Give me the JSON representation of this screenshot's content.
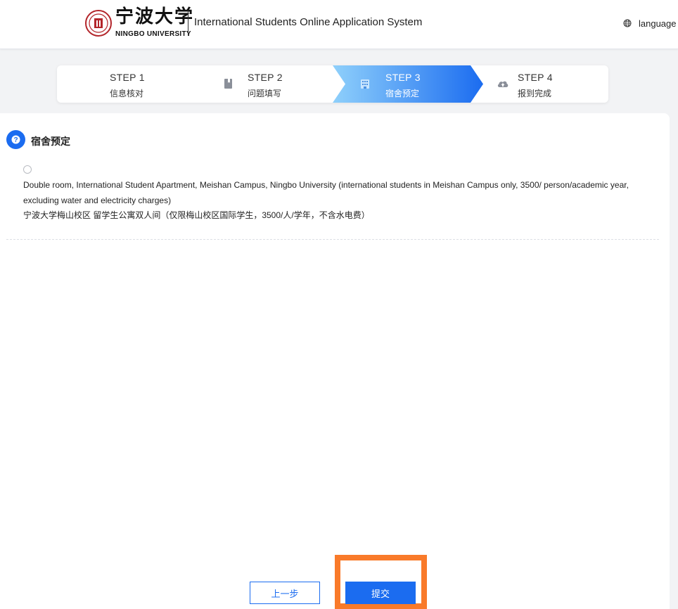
{
  "header": {
    "logo_cn": "宁波大学",
    "logo_en": "NINGBO UNIVERSITY",
    "system_title": "International Students Online Application System",
    "language_label": "language"
  },
  "stepper": {
    "steps": [
      {
        "title": "STEP 1",
        "subtitle": "信息核对",
        "icon": "none",
        "state": "done"
      },
      {
        "title": "STEP 2",
        "subtitle": "问题填写",
        "icon": "book-icon",
        "state": "done"
      },
      {
        "title": "STEP 3",
        "subtitle": "宿舍预定",
        "icon": "building-icon",
        "state": "active"
      },
      {
        "title": "STEP 4",
        "subtitle": "报到完成",
        "icon": "cloud-upload-icon",
        "state": "pending"
      }
    ],
    "active_gradient": [
      "#8fd0fb",
      "#1b6cf0"
    ]
  },
  "section": {
    "title": "宿舍预定",
    "icon": "question-circle-icon",
    "option": {
      "selected": false,
      "label_en": "Double room, International Student Apartment, Meishan Campus, Ningbo University (international students in Meishan Campus only, 3500/ person/academic year, excluding water and electricity charges)",
      "label_cn": "宁波大学梅山校区 留学生公寓双人间（仅限梅山校区国际学生，3500/人/学年，不含水电费）"
    }
  },
  "buttons": {
    "prev_label": "上一步",
    "submit_label": "提交"
  },
  "colors": {
    "primary": "#1b6cf0",
    "highlight": "#f97a2a",
    "seal": "#b3262b"
  }
}
